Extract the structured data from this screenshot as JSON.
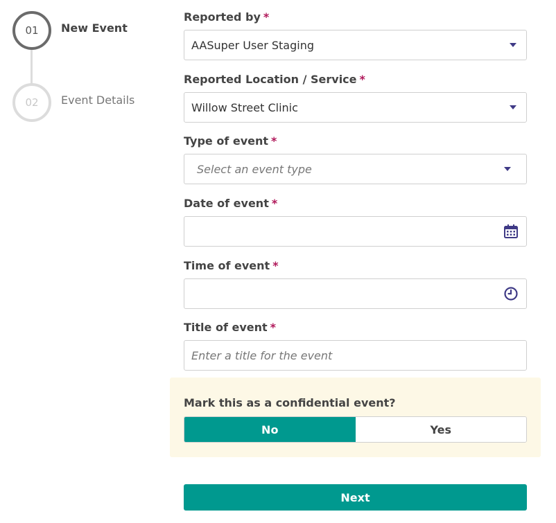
{
  "stepper": {
    "steps": [
      {
        "number": "01",
        "label": "New Event",
        "state": "active"
      },
      {
        "number": "02",
        "label": "Event Details",
        "state": "inactive"
      }
    ]
  },
  "form": {
    "reported_by": {
      "label": "Reported by",
      "required_mark": "*",
      "value": "AASuper User Staging"
    },
    "location": {
      "label": "Reported Location / Service",
      "required_mark": "*",
      "value": "Willow Street Clinic"
    },
    "event_type": {
      "label": "Type of event",
      "required_mark": "*",
      "placeholder": "Select an event type"
    },
    "date": {
      "label": "Date of event",
      "required_mark": "*",
      "value": ""
    },
    "time": {
      "label": "Time of event",
      "required_mark": "*",
      "value": ""
    },
    "title": {
      "label": "Title of event",
      "required_mark": "*",
      "placeholder": "Enter a title for the event"
    }
  },
  "confidential": {
    "question": "Mark this as a confidential event?",
    "options": [
      "No",
      "Yes"
    ],
    "selected": "No"
  },
  "actions": {
    "next_label": "Next"
  },
  "colors": {
    "accent": "#00998f",
    "required": "#b0185a",
    "icon": "#3f3a86",
    "panel_bg": "#fdf8e6"
  }
}
